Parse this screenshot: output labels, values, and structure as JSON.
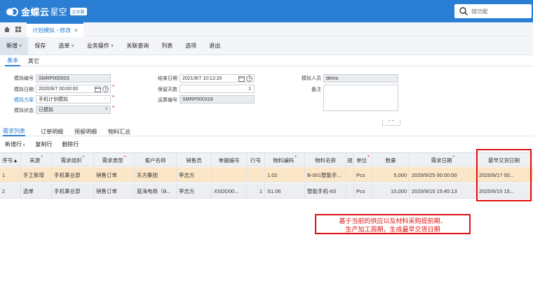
{
  "app": {
    "brand": "金蝶云",
    "brand2": "星空",
    "badge": "企业版"
  },
  "search": {
    "placeholder": "搜功能"
  },
  "page_tab": {
    "label": "计划模拟 - 修改",
    "close": "×"
  },
  "toolbar": {
    "items": [
      "新增",
      "保存",
      "选单",
      "业务操作",
      "关联查询",
      "列表",
      "选项",
      "退出"
    ]
  },
  "subtabs": [
    "基本",
    "其它"
  ],
  "form": {
    "sim_no_label": "模拟编号",
    "sim_no": "SMRP000003",
    "sim_date_label": "模拟日期",
    "sim_date": "2020/9/7 00:00:00",
    "scheme_label": "模拟方案",
    "scheme": "手机计划模拟",
    "status_label": "模拟状态",
    "status": "已模拟",
    "end_date_label": "结束日期",
    "end_date": "2021/9/7 10:12:20",
    "keep_days_label": "保留天数",
    "keep_days": "1",
    "calc_no_label": "运算编号",
    "calc_no": "SMRP000318",
    "user_label": "模拟人员",
    "user": "demo",
    "remark_label": "备注"
  },
  "collapse_glyph": "⌃⌃",
  "detail_tabs": [
    "需求列表",
    "订单明细",
    "预留明细",
    "物料汇总"
  ],
  "detail_toolbar": [
    "新增行",
    "复制行",
    "删除行"
  ],
  "grid": {
    "headers": [
      {
        "label": "序号▲",
        "req": false
      },
      {
        "label": "来源",
        "req": true
      },
      {
        "label": "需求组织",
        "req": true
      },
      {
        "label": "需求类型",
        "req": true
      },
      {
        "label": "客户名称",
        "req": false
      },
      {
        "label": "销售员",
        "req": false
      },
      {
        "label": "单据编号",
        "req": false
      },
      {
        "label": "行号",
        "req": false
      },
      {
        "label": "物料编码",
        "req": true
      },
      {
        "label": "物料名称",
        "req": false
      },
      {
        "label": "规",
        "req": false
      },
      {
        "label": "单位",
        "req": true
      },
      {
        "label": "数量",
        "req": false
      },
      {
        "label": "需求日期",
        "req": true
      },
      {
        "label": "最早交货日期",
        "req": false
      }
    ],
    "rows": [
      [
        "1",
        "手工新增",
        "手机事业部",
        "销售订单",
        "东方集团",
        "李志方",
        "",
        "",
        "1.02",
        "B-001智能手...",
        "",
        "Pcs",
        "5,000",
        "2020/9/25 00:00:00",
        "2020/9/17 00..."
      ],
      [
        "2",
        "选单",
        "手机事业部",
        "销售订单",
        "蓝海电商（B...",
        "李志方",
        "XSDD00...",
        "1",
        "S1.06",
        "智能手机-6S",
        "",
        "Pcs",
        "10,000",
        "2020/9/15 15:45:13",
        "2020/9/15 15..."
      ]
    ]
  },
  "note": {
    "line1": "基于当前的供应以及材料采购提前期、",
    "line2": "生产加工周期，生成最早交货日期"
  },
  "colors": {
    "brand": "#2a7fd4",
    "highlight": "#e01010",
    "selected_row": "#fce6c8"
  }
}
